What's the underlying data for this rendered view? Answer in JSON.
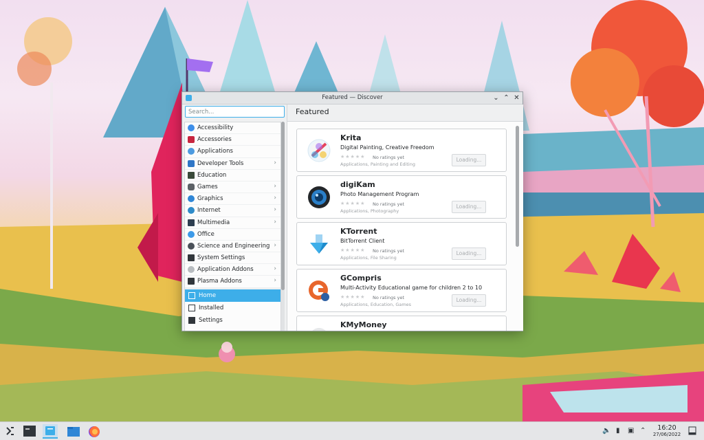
{
  "window": {
    "title": "Featured — Discover"
  },
  "sidebar": {
    "search_placeholder": "Search...",
    "categories": [
      {
        "label": "Accessibility",
        "icon": "accessibility-icon",
        "has_submenu": false
      },
      {
        "label": "Accessories",
        "icon": "accessories-icon",
        "has_submenu": false
      },
      {
        "label": "Applications",
        "icon": "applications-icon",
        "has_submenu": false
      },
      {
        "label": "Developer Tools",
        "icon": "developer-tools-icon",
        "has_submenu": true
      },
      {
        "label": "Education",
        "icon": "education-icon",
        "has_submenu": false
      },
      {
        "label": "Games",
        "icon": "gamepad-icon",
        "has_submenu": true
      },
      {
        "label": "Graphics",
        "icon": "graphics-icon",
        "has_submenu": true
      },
      {
        "label": "Internet",
        "icon": "globe-icon",
        "has_submenu": true
      },
      {
        "label": "Multimedia",
        "icon": "multimedia-icon",
        "has_submenu": true
      },
      {
        "label": "Office",
        "icon": "office-icon",
        "has_submenu": false
      },
      {
        "label": "Science and Engineering",
        "icon": "science-icon",
        "has_submenu": true
      },
      {
        "label": "System Settings",
        "icon": "system-settings-icon",
        "has_submenu": false
      },
      {
        "label": "Application Addons",
        "icon": "addons-icon",
        "has_submenu": true
      },
      {
        "label": "Plasma Addons",
        "icon": "plasma-addons-icon",
        "has_submenu": true
      }
    ],
    "nav": {
      "home": "Home",
      "installed": "Installed",
      "settings": "Settings"
    }
  },
  "content": {
    "page_title": "Featured",
    "apps": [
      {
        "name": "Krita",
        "description": "Digital Painting, Creative Freedom",
        "ratings": "No ratings yet",
        "categories": "Applications, Painting and Editing",
        "button": "Loading...",
        "icon": "krita-icon"
      },
      {
        "name": "digiKam",
        "description": "Photo Management Program",
        "ratings": "No ratings yet",
        "categories": "Applications, Photography",
        "button": "Loading...",
        "icon": "digikam-icon"
      },
      {
        "name": "KTorrent",
        "description": "BitTorrent Client",
        "ratings": "No ratings yet",
        "categories": "Applications, File Sharing",
        "button": "Loading...",
        "icon": "ktorrent-icon"
      },
      {
        "name": "GCompris",
        "description": "Multi-Activity Educational game for children 2 to 10",
        "ratings": "No ratings yet",
        "categories": "Applications, Education, Games",
        "button": "Loading...",
        "icon": "gcompris-icon"
      },
      {
        "name": "KMyMoney",
        "description": "",
        "ratings": "",
        "categories": "",
        "button": "",
        "icon": "kmymoney-icon"
      }
    ]
  },
  "taskbar": {
    "time": "16:20",
    "date": "27/06/2022"
  },
  "colors": {
    "accent": "#3daee9",
    "window_bg": "#eff0f1",
    "card_bg": "#ffffff",
    "taskbar_bg": "#e5e6e8"
  }
}
